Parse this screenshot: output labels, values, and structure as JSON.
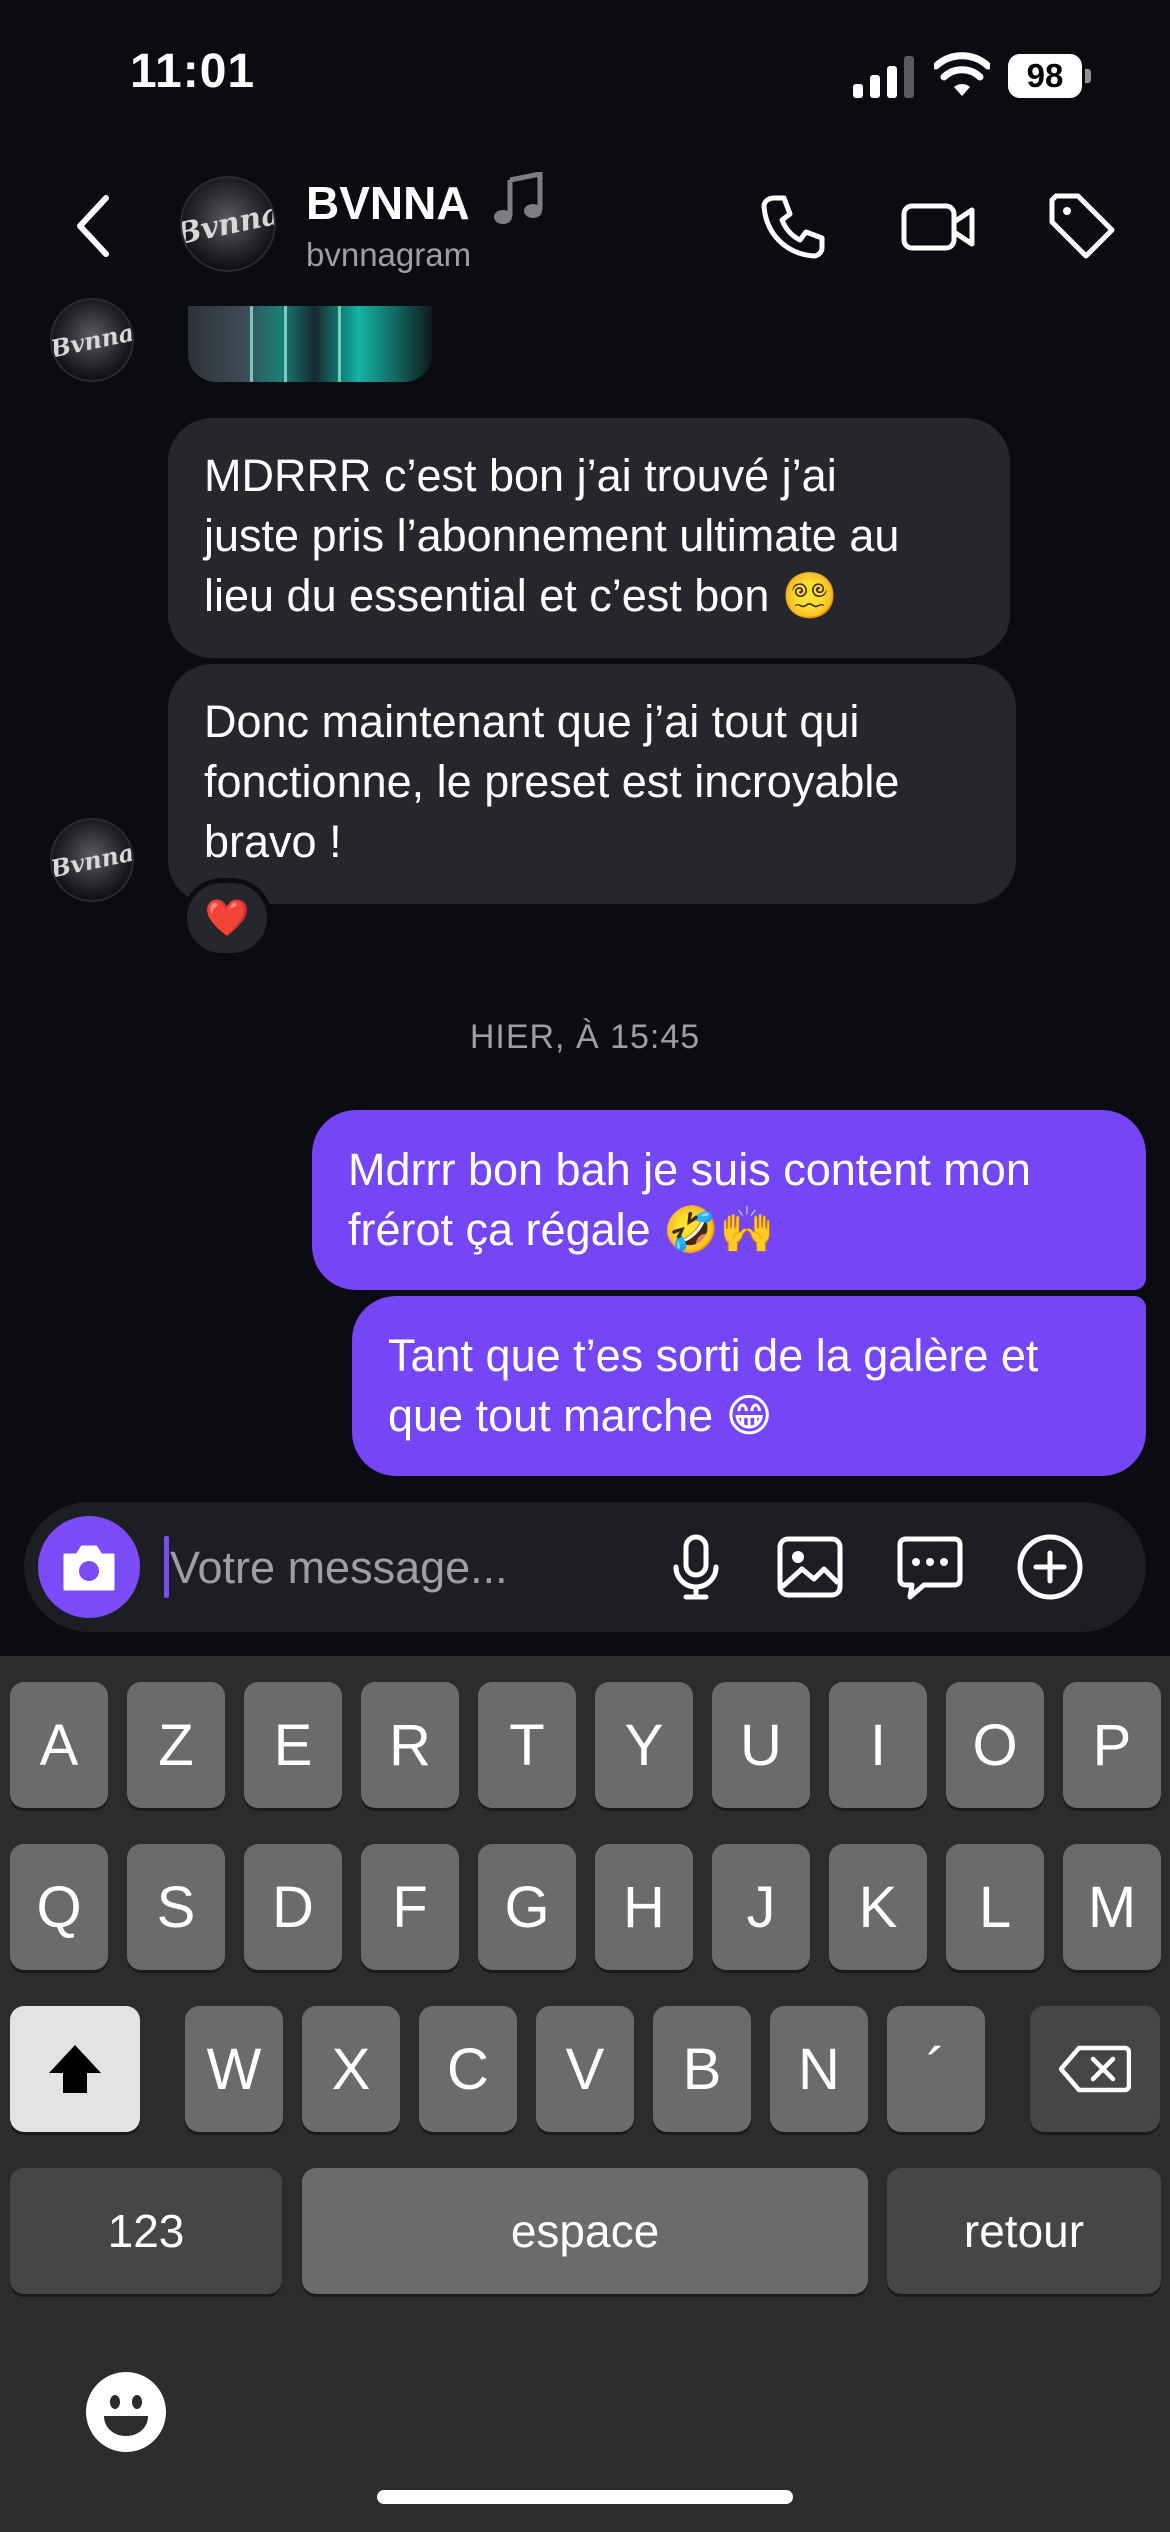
{
  "status_bar": {
    "time": "11:01",
    "battery": "98"
  },
  "header": {
    "back_icon": "chevron-left-icon",
    "avatar_logo": "Bvnna",
    "name": "BVNNA",
    "name_emoji": "music-note-icon",
    "handle": "bvnnagram",
    "actions": [
      "phone-icon",
      "video-camera-icon",
      "tag-icon"
    ]
  },
  "messages": {
    "incoming": [
      {
        "text": "MDRRR c’est bon j’ai trouvé j’ai juste pris l’abonnement ultimate au lieu du essential et c’est bon 😵‍💫",
        "lines": [
          "MDRRR c’est bon j’ai trouvé j’ai",
          "juste pris l’abonnement ultimate au",
          "lieu du essential et c’est bon 😵‍💫"
        ]
      },
      {
        "text": "Donc maintenant que j’ai tout qui fonctionne, le preset est incroyable bravo !",
        "lines": [
          "Donc maintenant que j’ai tout qui",
          "fonctionne, le preset est incroyable",
          "bravo !"
        ],
        "reaction": "❤️"
      }
    ],
    "timestamp": "HIER, À 15:45",
    "outgoing": [
      {
        "text": "Mdrrr bon bah je suis content mon frérot ça régale 🤣🙌",
        "lines": [
          "Mdrrr bon bah je suis content mon",
          "frérot ça régale 🤣🙌"
        ]
      },
      {
        "text": "Tant que t’es sorti de la galère et que tout marche 😁",
        "lines": [
          "Tant que t’es sorti de la galère et",
          "que tout marche 😁"
        ]
      }
    ]
  },
  "composer": {
    "placeholder": "Votre message...",
    "value": "",
    "icons": [
      "camera-icon",
      "microphone-icon",
      "gallery-icon",
      "sticker-icon",
      "plus-circle-icon"
    ]
  },
  "keyboard": {
    "row1": [
      "A",
      "Z",
      "E",
      "R",
      "T",
      "Y",
      "U",
      "I",
      "O",
      "P"
    ],
    "row2": [
      "Q",
      "S",
      "D",
      "F",
      "G",
      "H",
      "J",
      "K",
      "L",
      "M"
    ],
    "row3": [
      "W",
      "X",
      "C",
      "V",
      "B",
      "N",
      "´"
    ],
    "numbers": "123",
    "space": "espace",
    "return": "retour"
  },
  "colors": {
    "background": "#0b0c11",
    "incoming_bubble": "#26272d",
    "outgoing_bubble": "#7546f5",
    "accent": "#7a4cf7"
  }
}
